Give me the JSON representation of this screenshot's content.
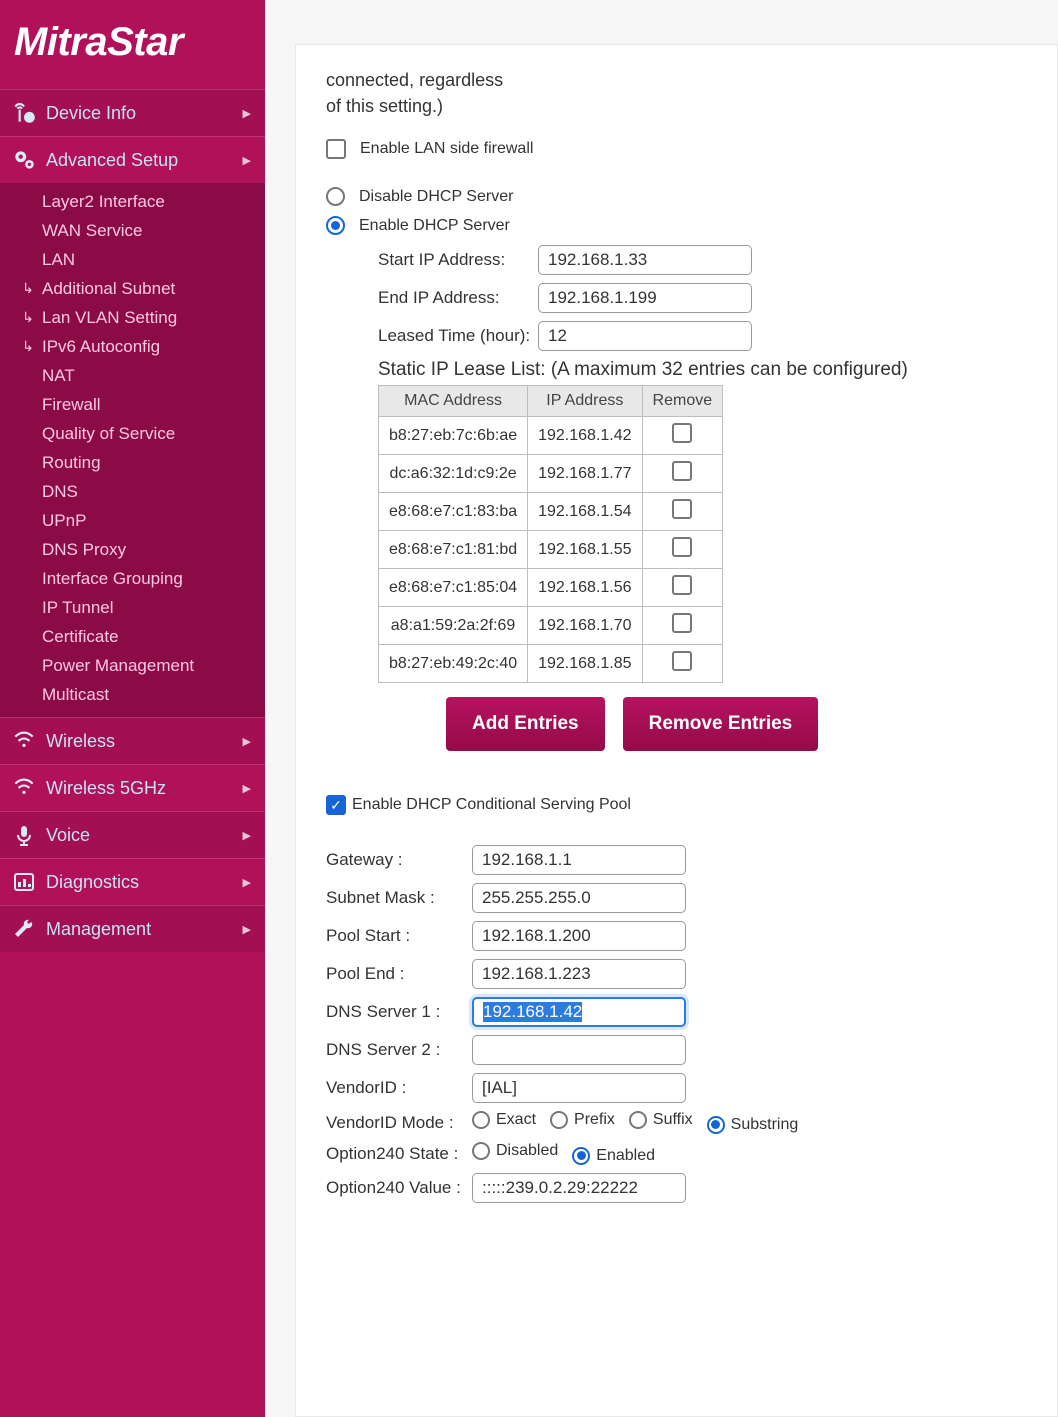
{
  "brand": "MitraStar",
  "sidebar": {
    "items": [
      {
        "label": "Device Info",
        "icon": "antenna-info"
      },
      {
        "label": "Advanced Setup",
        "icon": "gears",
        "expanded": true
      },
      {
        "label": "Wireless",
        "icon": "wireless"
      },
      {
        "label": "Wireless 5GHz",
        "icon": "wireless"
      },
      {
        "label": "Voice",
        "icon": "microphone"
      },
      {
        "label": "Diagnostics",
        "icon": "bar-chart"
      },
      {
        "label": "Management",
        "icon": "wrench"
      }
    ],
    "advanced_sub": [
      {
        "label": "Layer2 Interface"
      },
      {
        "label": "WAN Service"
      },
      {
        "label": "LAN"
      },
      {
        "label": "Additional Subnet",
        "indent": true
      },
      {
        "label": "Lan VLAN Setting",
        "indent": true
      },
      {
        "label": "IPv6 Autoconfig",
        "indent": true
      },
      {
        "label": "NAT"
      },
      {
        "label": "Firewall"
      },
      {
        "label": "Quality of Service"
      },
      {
        "label": "Routing"
      },
      {
        "label": "DNS"
      },
      {
        "label": "UPnP"
      },
      {
        "label": "DNS Proxy"
      },
      {
        "label": "Interface Grouping"
      },
      {
        "label": "IP Tunnel"
      },
      {
        "label": "Certificate"
      },
      {
        "label": "Power Management"
      },
      {
        "label": "Multicast"
      }
    ]
  },
  "note_lines": [
    "connected, regardless",
    "of this setting.)"
  ],
  "lan_firewall": {
    "label": "Enable LAN side firewall",
    "checked": false
  },
  "dhcp_server": {
    "disable_label": "Disable DHCP Server",
    "enable_label": "Enable DHCP Server",
    "selected": "enable",
    "fields": {
      "start_label": "Start IP Address:",
      "start_value": "192.168.1.33",
      "end_label": "End IP Address:",
      "end_value": "192.168.1.199",
      "lease_label": "Leased Time (hour):",
      "lease_value": "12"
    }
  },
  "static_lease": {
    "title": "Static IP Lease List: (A maximum 32 entries can be configured)",
    "headers": [
      "MAC Address",
      "IP Address",
      "Remove"
    ],
    "rows": [
      {
        "mac": "b8:27:eb:7c:6b:ae",
        "ip": "192.168.1.42"
      },
      {
        "mac": "dc:a6:32:1d:c9:2e",
        "ip": "192.168.1.77"
      },
      {
        "mac": "e8:68:e7:c1:83:ba",
        "ip": "192.168.1.54"
      },
      {
        "mac": "e8:68:e7:c1:81:bd",
        "ip": "192.168.1.55"
      },
      {
        "mac": "e8:68:e7:c1:85:04",
        "ip": "192.168.1.56"
      },
      {
        "mac": "a8:a1:59:2a:2f:69",
        "ip": "192.168.1.70"
      },
      {
        "mac": "b8:27:eb:49:2c:40",
        "ip": "192.168.1.85"
      }
    ],
    "add_button": "Add Entries",
    "remove_button": "Remove Entries"
  },
  "cond_pool": {
    "enable_label": "Enable DHCP Conditional Serving Pool",
    "enable_checked": true,
    "fields": {
      "gateway_label": "Gateway :",
      "gateway_value": "192.168.1.1",
      "subnet_label": "Subnet Mask :",
      "subnet_value": "255.255.255.0",
      "poolstart_label": "Pool Start :",
      "poolstart_value": "192.168.1.200",
      "poolend_label": "Pool End :",
      "poolend_value": "192.168.1.223",
      "dns1_label": "DNS Server 1 :",
      "dns1_value": "192.168.1.42",
      "dns2_label": "DNS Server 2 :",
      "dns2_value": "",
      "vendorid_label": "VendorID :",
      "vendorid_value": "[IAL]",
      "vendormode_label": "VendorID Mode :",
      "vendormode_options": [
        "Exact",
        "Prefix",
        "Suffix",
        "Substring"
      ],
      "vendormode_selected": "Substring",
      "opt240state_label": "Option240 State :",
      "opt240state_options": [
        "Disabled",
        "Enabled"
      ],
      "opt240state_selected": "Enabled",
      "opt240value_label": "Option240 Value :",
      "opt240value_value": ":::::239.0.2.29:22222"
    }
  }
}
